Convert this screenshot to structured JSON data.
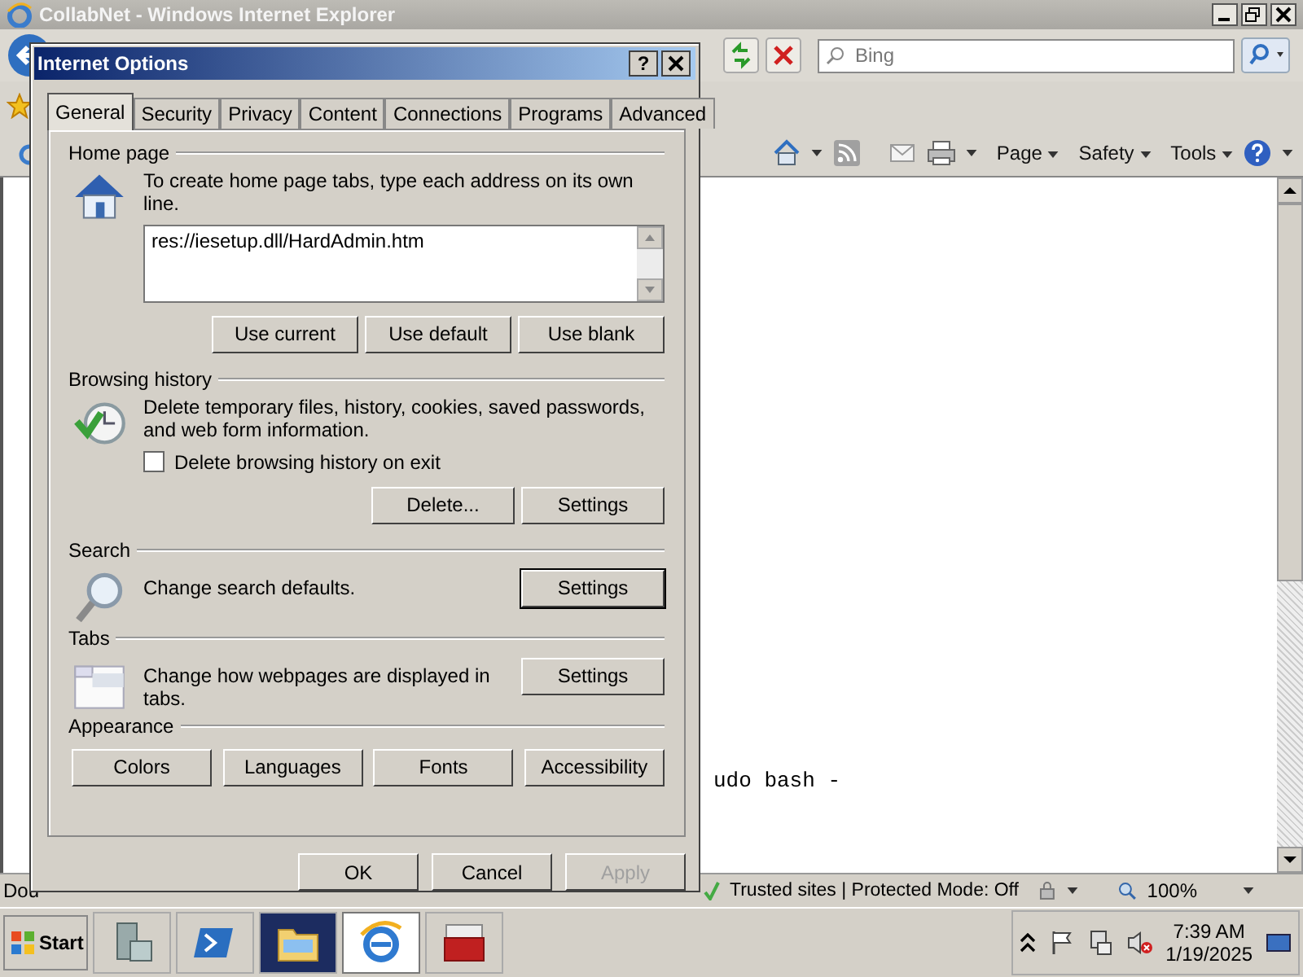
{
  "browser": {
    "title": "CollabNet - Windows Internet Explorer",
    "search_placeholder": "Bing",
    "command_bar": [
      "Page",
      "Safety",
      "Tools"
    ],
    "page_right": [
      {
        "text": "udo bash -",
        "kind": "code"
      }
    ],
    "status": {
      "left": "Dou",
      "zone": "Trusted sites | Protected Mode: Off",
      "zoom": "100%"
    }
  },
  "dialog": {
    "title": "Internet Options",
    "help": "?",
    "tabs": [
      {
        "label": "General",
        "selected": true
      },
      {
        "label": "Security",
        "selected": false
      },
      {
        "label": "Privacy",
        "selected": false
      },
      {
        "label": "Content",
        "selected": false
      },
      {
        "label": "Connections",
        "selected": false
      },
      {
        "label": "Programs",
        "selected": false
      },
      {
        "label": "Advanced",
        "selected": false
      }
    ],
    "home": {
      "heading": "Home page",
      "text": "To create home page tabs, type each address on its own line.",
      "value": "res://iesetup.dll/HardAdmin.htm",
      "buttons": [
        "Use current",
        "Use default",
        "Use blank"
      ]
    },
    "history": {
      "heading": "Browsing history",
      "text": "Delete temporary files, history, cookies, saved passwords, and web form information.",
      "checkbox": {
        "label": "Delete browsing history on exit",
        "checked": false
      },
      "buttons": [
        "Delete...",
        "Settings"
      ]
    },
    "search": {
      "heading": "Search",
      "text": "Change search defaults.",
      "button": "Settings",
      "focused": true
    },
    "tabs_group": {
      "heading": "Tabs",
      "text": "Change how webpages are displayed in tabs.",
      "button": "Settings",
      "focused": false
    },
    "appearance": {
      "heading": "Appearance",
      "buttons": [
        "Colors",
        "Languages",
        "Fonts",
        "Accessibility"
      ]
    },
    "footer": [
      {
        "label": "OK",
        "disabled": false
      },
      {
        "label": "Cancel",
        "disabled": false
      },
      {
        "label": "Apply",
        "disabled": true
      }
    ]
  },
  "taskbar": {
    "start": "Start",
    "time": "7:39 AM",
    "date": "1/19/2025",
    "apps": [
      {
        "kind": "server",
        "selected": false
      },
      {
        "kind": "shell",
        "selected": false
      },
      {
        "kind": "folder",
        "selected": false
      },
      {
        "kind": "browser",
        "selected": true
      },
      {
        "kind": "toolbox",
        "selected": false
      }
    ]
  }
}
